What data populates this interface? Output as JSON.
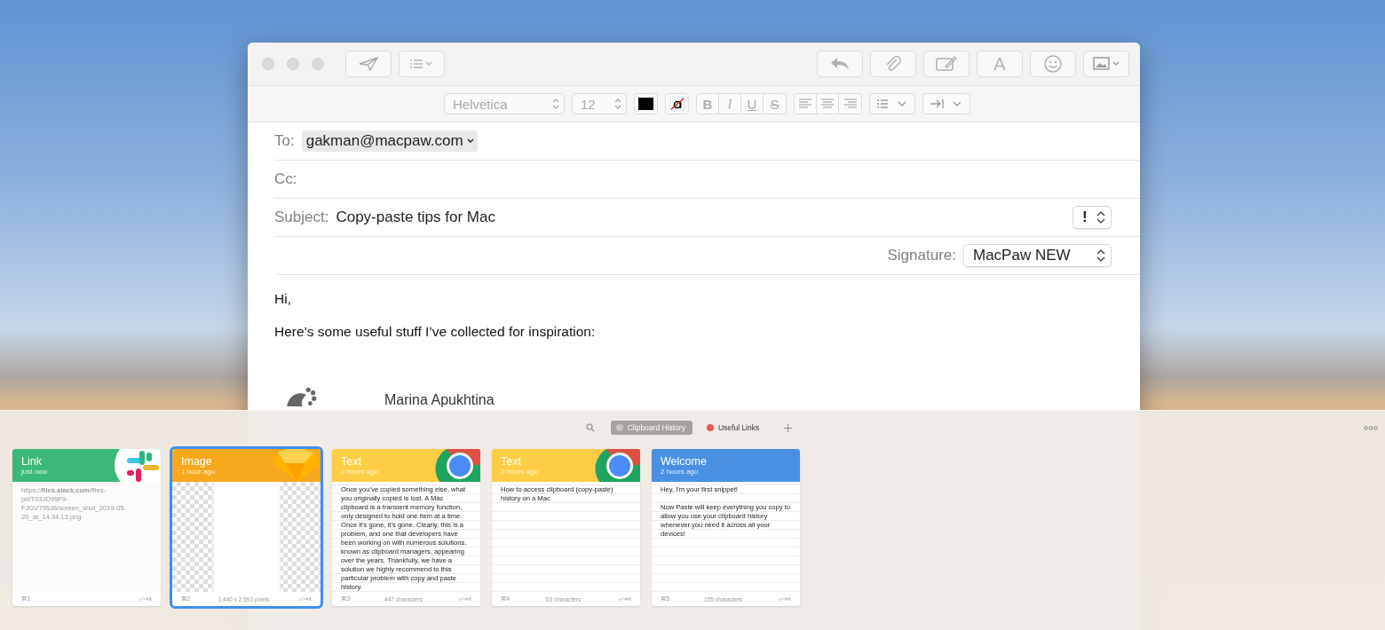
{
  "mail_window": {
    "toolbar": {
      "fonts_button": "A"
    },
    "format_bar": {
      "font": "Helvetica",
      "size": "12",
      "style_buttons": [
        "B",
        "I",
        "U",
        "S"
      ]
    },
    "to": {
      "label": "To:",
      "recipients": [
        "gakman@macpaw.com"
      ]
    },
    "cc": {
      "label": "Cc:"
    },
    "subject": {
      "label": "Subject:",
      "value": "Copy-paste tips for Mac",
      "priority": "!"
    },
    "signature": {
      "label": "Signature:",
      "value": "MacPaw NEW"
    },
    "body": [
      "Hi,",
      "Here’s some useful stuff I’ve collected for inspiration:"
    ],
    "signature_name": "Marina Apukhtina"
  },
  "paste_panel": {
    "pinboards": [
      {
        "label": "Clipboard History",
        "color": "#c9c5c2",
        "selected": true
      },
      {
        "label": "Useful Links",
        "color": "#f2545b",
        "selected": false
      }
    ],
    "cards": [
      {
        "kind": "link",
        "title": "Link",
        "time": "just now",
        "color": "#3cb878",
        "content": "https://**files.slack.com**/files-pri/T03JD99F9-FJGV795J6/screen_shot_2019-05-20_at_14.34.13.png",
        "shortcut": "⌘1",
        "selected": false
      },
      {
        "kind": "image",
        "title": "Image",
        "time": "1 hour ago",
        "color": "#f8a81c",
        "info": "1,440 x 2,593 pixels",
        "shortcut": "⌘2",
        "selected": true
      },
      {
        "kind": "text",
        "title": "Text",
        "time": "2 hours ago",
        "color": "#fecd45",
        "content": "Once you’ve copied something else, what you originally copied is lost. A Mac clipboard is a transient memory function, only designed to hold one item at a time. Once it’s gone, it’s gone. Clearly, this is a problem, and one that developers have been working on with numerous solutions, known as clipboard managers, appearing over the years. Thankfully, we have a solution we highly recommend to this particular problem with copy and paste history.",
        "info": "447 characters",
        "shortcut": "⌘3",
        "selected": false
      },
      {
        "kind": "text",
        "title": "Text",
        "time": "2 hours ago",
        "color": "#fecd45",
        "content": "How to access clipboard (copy-paste) history on a Mac",
        "info": "53 characters",
        "shortcut": "⌘4",
        "selected": false
      },
      {
        "kind": "note",
        "title": "Welcome",
        "time": "2 hours ago",
        "color": "#4a90e2",
        "content": "Hey, I'm your first snippet!\n\nNow Paste will keep everything you copy to allow you use your clipboard history whenever you need it across all your devices!",
        "info": "155 characters",
        "shortcut": "⌘5",
        "selected": false
      }
    ]
  }
}
